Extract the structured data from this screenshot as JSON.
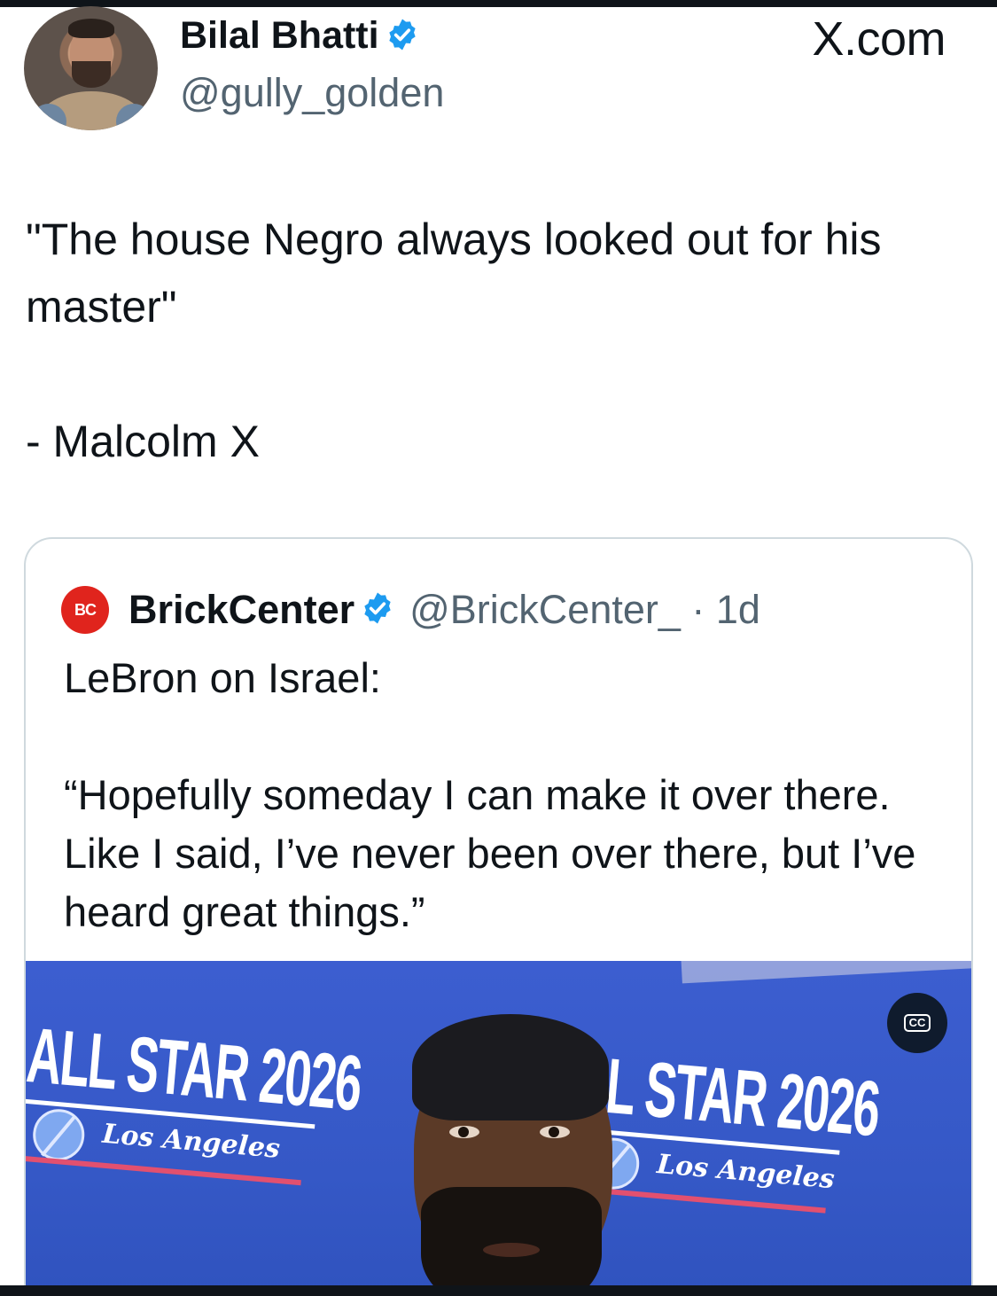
{
  "post": {
    "author_name": "Bilal Bhatti",
    "author_handle": "@gully_golden",
    "verified": true,
    "site_label": "X.com",
    "text": "\"The house Negro always looked out for his master\"\n\n- Malcolm X"
  },
  "quoted_post": {
    "logo_text": "BC",
    "author_name": "BrickCenter",
    "verified": true,
    "handle_and_time": "@BrickCenter_ · 1d",
    "text": "LeBron on Israel:\n\n“Hopefully someday I can make it over there. Like I said, I’ve never been over there, but I’ve heard great things.”",
    "media": {
      "banner_left_title": "ALL STAR 2026",
      "banner_left_subtitle": "Los Angeles",
      "banner_right_title": "LL STAR 2026",
      "banner_right_subtitle": "Los Angeles",
      "cc_label": "CC"
    }
  },
  "colors": {
    "text": "#0f1419",
    "secondary_text": "#536471",
    "verified_badge": "#1d9bf0",
    "card_border": "#cfd9de",
    "media_backdrop": "#3558c6",
    "brickcenter_red": "#e0241d"
  },
  "icons": [
    "verified-badge-icon",
    "brickcenter-logo",
    "closed-captions-icon"
  ]
}
